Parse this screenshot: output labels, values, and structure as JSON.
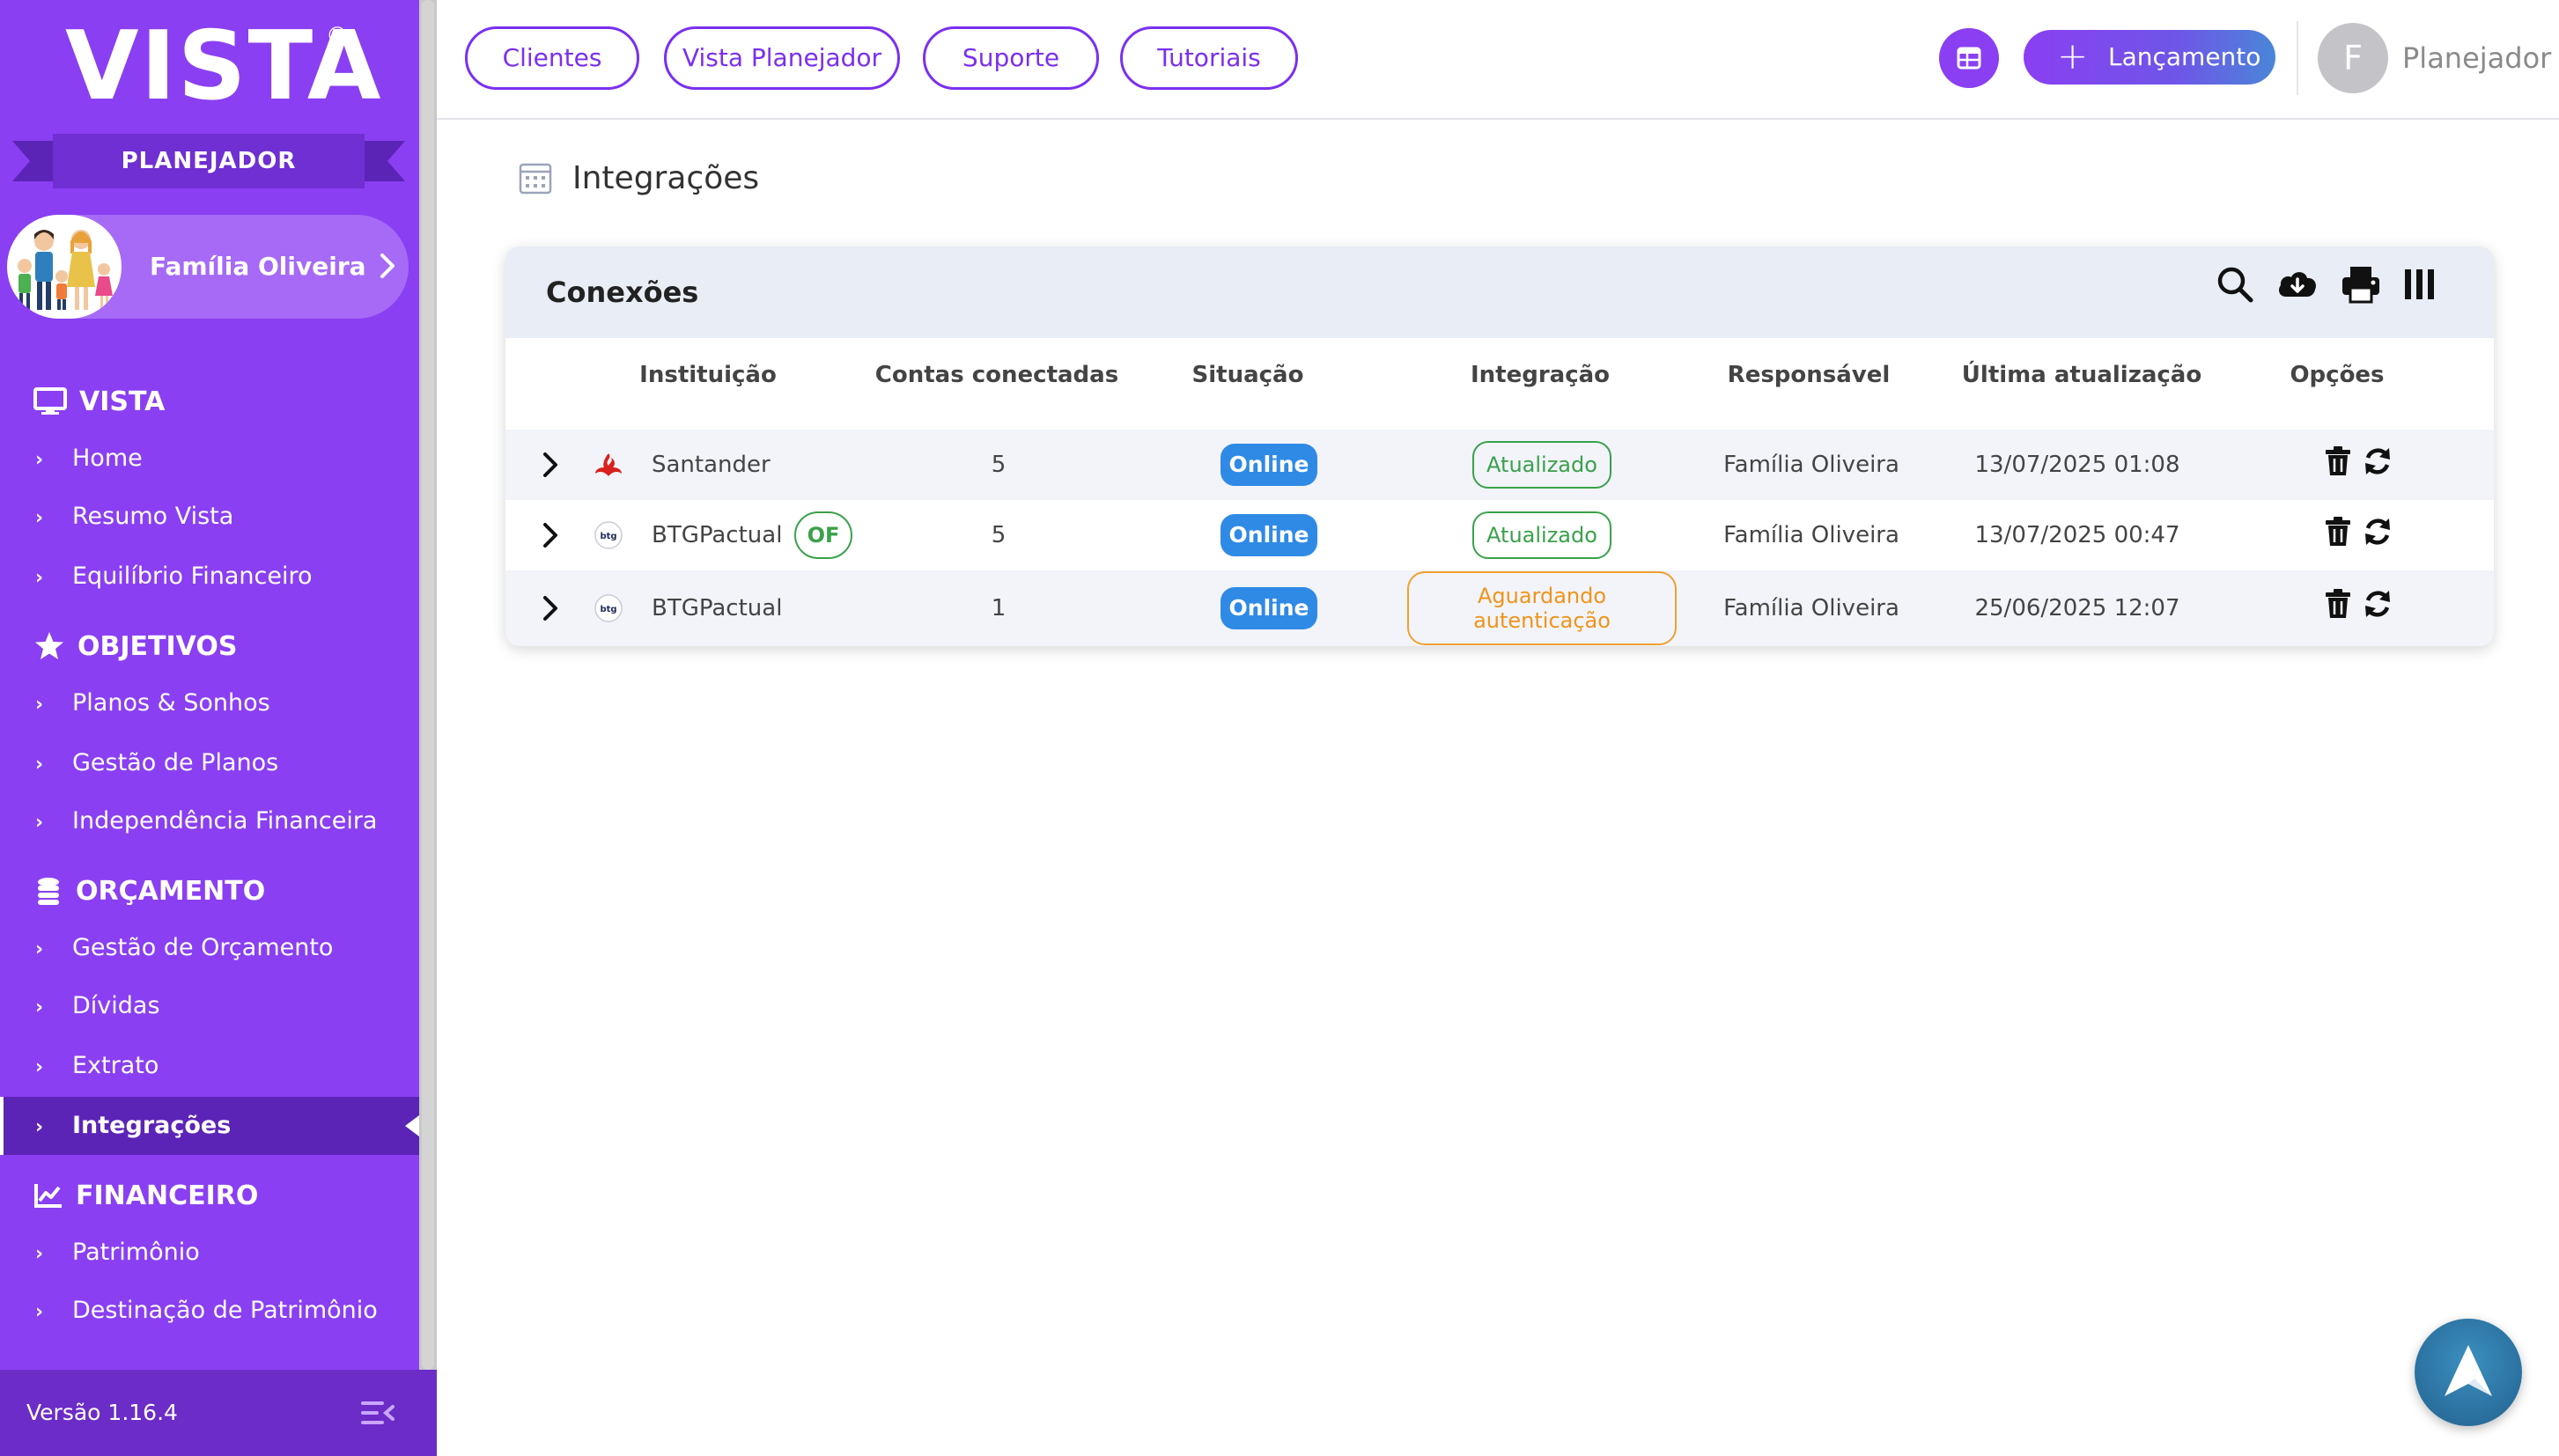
{
  "sidebar": {
    "logo_text": "VISTA",
    "logo_reg": "®",
    "ribbon_label": "PLANEJADOR",
    "profile_name": "Família Oliveira",
    "sections": [
      {
        "title": "VISTA",
        "icon": "monitor-icon",
        "items": [
          "Home",
          "Resumo Vista",
          "Equilíbrio Financeiro"
        ]
      },
      {
        "title": "OBJETIVOS",
        "icon": "star-icon",
        "items": [
          "Planos & Sonhos",
          "Gestão de Planos",
          "Independência Financeira"
        ]
      },
      {
        "title": "ORÇAMENTO",
        "icon": "coins-icon",
        "items": [
          "Gestão de Orçamento",
          "Dívidas",
          "Extrato",
          "Integrações"
        ]
      },
      {
        "title": "FINANCEIRO",
        "icon": "chart-line-icon",
        "items": [
          "Patrimônio",
          "Destinação de Patrimônio"
        ]
      }
    ],
    "active_item": "Integrações",
    "version": "Versão 1.16.4"
  },
  "topbar": {
    "nav_buttons": [
      "Clientes",
      "Vista Planejador",
      "Suporte",
      "Tutoriais"
    ],
    "launch_label": "Lançamento",
    "user_initial": "F",
    "user_name": "Planejador"
  },
  "page": {
    "title": "Integrações"
  },
  "card": {
    "title": "Conexões",
    "tools": [
      "search-icon",
      "cloud-download-icon",
      "print-icon",
      "columns-icon"
    ],
    "columns": [
      "Instituição",
      "Contas conectadas",
      "Situação",
      "Integração",
      "Responsável",
      "Última atualização",
      "Opções"
    ],
    "rows": [
      {
        "institution": "Santander",
        "bank_icon": "santander-icon",
        "of_badge": "",
        "accounts": "5",
        "status": "Online",
        "integration": "Atualizado",
        "integration_state": "ok",
        "responsible": "Família Oliveira",
        "updated": "13/07/2025 01:08"
      },
      {
        "institution": "BTGPactual",
        "bank_icon": "btg-icon",
        "of_badge": "OF",
        "accounts": "5",
        "status": "Online",
        "integration": "Atualizado",
        "integration_state": "ok",
        "responsible": "Família Oliveira",
        "updated": "13/07/2025 00:47"
      },
      {
        "institution": "BTGPactual",
        "bank_icon": "btg-icon",
        "of_badge": "",
        "accounts": "1",
        "status": "Online",
        "integration": "Aguardando autenticação",
        "integration_state": "waiting",
        "responsible": "Família Oliveira",
        "updated": "25/06/2025 12:07"
      }
    ]
  },
  "colors": {
    "sidebar": "#8a3ff2",
    "sidebar_active": "#5c24b6",
    "accent": "#7b2ff0",
    "online": "#2f8ae6",
    "ok": "#3aa14a",
    "waiting": "#f0941a"
  }
}
